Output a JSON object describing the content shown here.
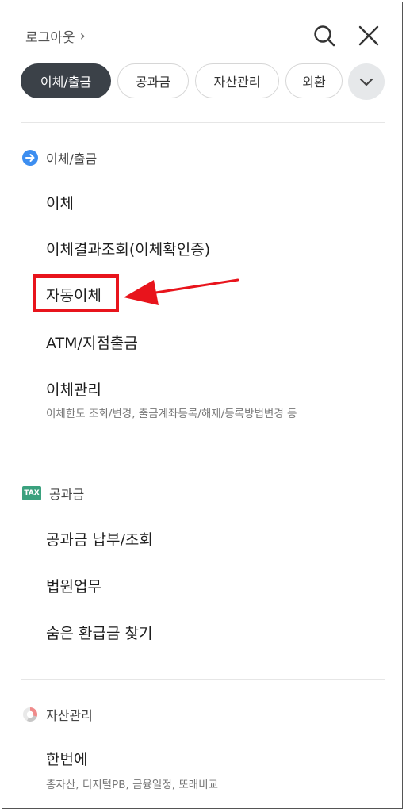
{
  "header": {
    "logout_label": "로그아웃",
    "chevron": "›"
  },
  "tabs": [
    {
      "label": "이체/출금",
      "active": true
    },
    {
      "label": "공과금",
      "active": false
    },
    {
      "label": "자산관리",
      "active": false
    },
    {
      "label": "외환",
      "active": false
    }
  ],
  "sections": {
    "transfer": {
      "title": "이체/출금",
      "items": [
        {
          "label": "이체"
        },
        {
          "label": "이체결과조회(이체확인증)"
        },
        {
          "label": "자동이체"
        },
        {
          "label": "ATM/지점출금"
        },
        {
          "label": "이체관리",
          "desc": "이체한도 조회/변경, 출금계좌등록/해제/등록방법변경 등"
        }
      ]
    },
    "utility": {
      "title": "공과금",
      "badge": "TAX",
      "items": [
        {
          "label": "공과금 납부/조회"
        },
        {
          "label": "법원업무"
        },
        {
          "label": "숨은 환급금 찾기"
        }
      ]
    },
    "asset": {
      "title": "자산관리",
      "items": [
        {
          "label": "한번에",
          "desc": "총자산, 디지털PB, 금융일정, 또래비교"
        }
      ]
    }
  },
  "colors": {
    "active_tab": "#3b4148",
    "highlight": "#e8141c",
    "transfer_icon": "#3d8ef0",
    "tax_badge": "#3aa17e"
  },
  "icons": [
    "search-icon",
    "close-icon",
    "chevron-down-icon",
    "arrow-right-circle-icon",
    "tax-icon",
    "pie-chart-icon"
  ]
}
